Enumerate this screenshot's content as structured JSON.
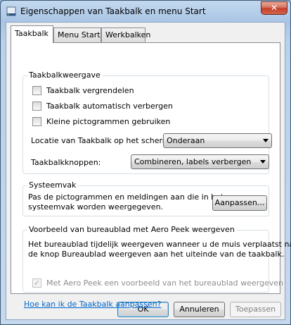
{
  "window": {
    "title": "Eigenschappen van Taakbalk en menu Start",
    "close_label": "✕"
  },
  "tabs": [
    {
      "label": "Taakbalk",
      "active": true
    },
    {
      "label": "Menu Start",
      "active": false
    },
    {
      "label": "Werkbalken",
      "active": false
    }
  ],
  "taskbar_appearance": {
    "title": "Taakbalkweergave",
    "lock_label": "Taakbalk vergrendelen",
    "lock_checked": false,
    "autohide_label": "Taakbalk automatisch verbergen",
    "autohide_checked": false,
    "small_icons_label": "Kleine pictogrammen gebruiken",
    "small_icons_checked": false,
    "location_label": "Locatie van Taakbalk op het scherm:",
    "location_value": "Onderaan",
    "buttons_label": "Taakbalkknoppen:",
    "buttons_value": "Combineren, labels verbergen"
  },
  "notification_area": {
    "title": "Systeemvak",
    "description_line1": "Pas de pictogrammen en meldingen aan die in het",
    "description_line2": "systeemvak worden weergegeven.",
    "customize_label": "Aanpassen..."
  },
  "aero_peek": {
    "title": "Voorbeeld van bureaublad met Aero Peek weergeven",
    "description_line1": "Het bureaublad tijdelijk weergeven wanneer u de muis verplaatst naar",
    "description_line2": "de knop Bureaublad weergeven aan het uiteinde van de taakbalk.",
    "checkbox_label": "Met Aero Peek een voorbeeld van het bureaublad weergeven",
    "checkbox_checked": true,
    "checkbox_enabled": false,
    "check_glyph": "✓"
  },
  "help_link": "Hoe kan ik de Taakbalk aanpassen?",
  "buttons": {
    "ok": "OK",
    "cancel": "Annuleren",
    "apply": "Toepassen"
  },
  "colors": {
    "link": "#0066cc",
    "close_button": "#c4402a"
  }
}
